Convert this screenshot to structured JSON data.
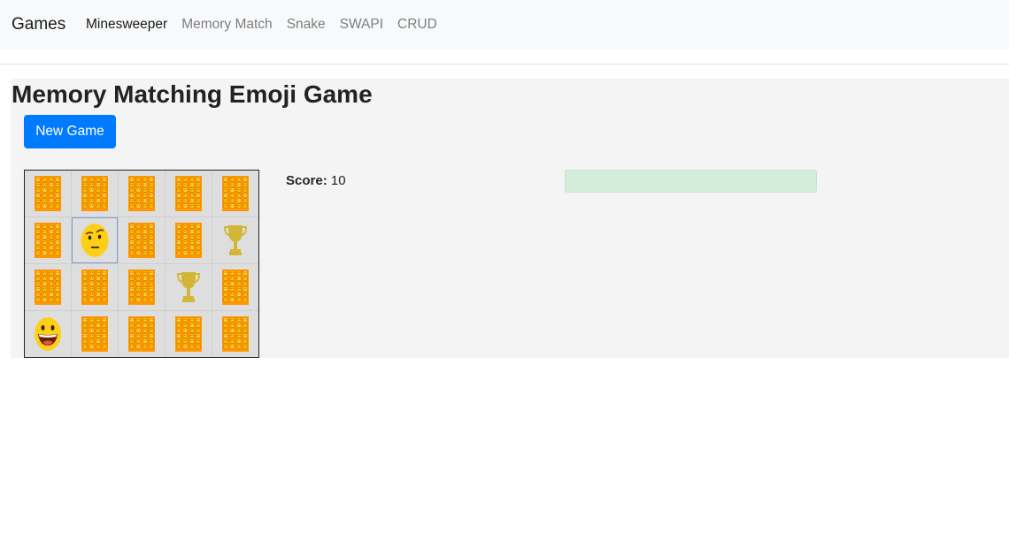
{
  "navbar": {
    "brand": "Games",
    "items": [
      {
        "label": "Minesweeper",
        "active": true
      },
      {
        "label": "Memory Match",
        "active": false
      },
      {
        "label": "Snake",
        "active": false
      },
      {
        "label": "SWAPI",
        "active": false
      },
      {
        "label": "CRUD",
        "active": false
      }
    ]
  },
  "game": {
    "title": "Memory Matching Emoji Game",
    "new_game_label": "New Game",
    "score_label": "Score:",
    "score_value": "10",
    "status_message": "",
    "colors": {
      "button": "#007bff",
      "alert_bg": "#d4edda",
      "card_back": "#ff9800",
      "emoji": "#fdd017",
      "trophy": "#d4b637"
    },
    "board": {
      "columns": 5,
      "rows": 4,
      "cells": [
        "back",
        "back",
        "back",
        "back",
        "back",
        "back",
        "raised-eyebrow-emoji",
        "back",
        "back",
        "trophy",
        "back",
        "back",
        "back",
        "trophy",
        "back",
        "grinning-emoji",
        "back",
        "back",
        "back",
        "back"
      ],
      "selected_index": 6
    }
  }
}
